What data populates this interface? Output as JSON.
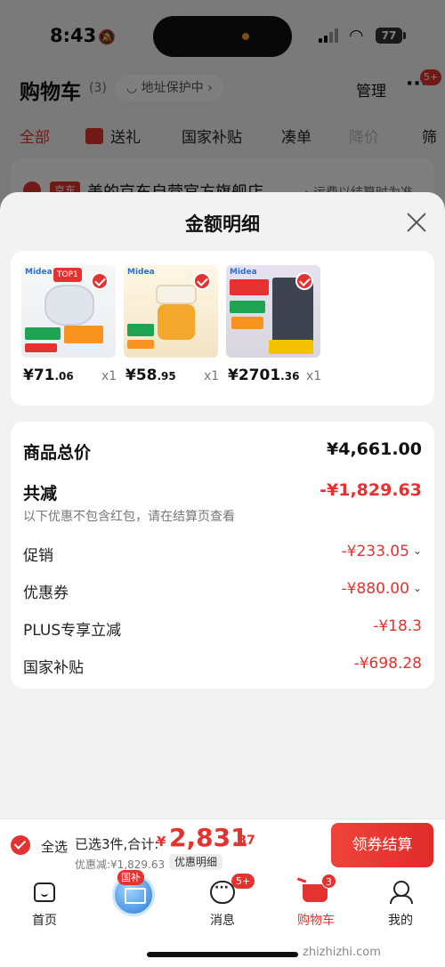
{
  "status": {
    "time": "8:43",
    "battery": "77"
  },
  "header": {
    "title": "购物车",
    "count": "(3)",
    "address_pill": "◡ 地址保护中 ›",
    "manage": "管理",
    "more_badge": "5+"
  },
  "tabs": [
    {
      "label": "全部"
    },
    {
      "label": "送礼"
    },
    {
      "label": "国家补贴"
    },
    {
      "label": "凑单"
    },
    {
      "label": "降价"
    },
    {
      "label": "筛"
    }
  ],
  "store": {
    "tag": "京东",
    "name": "美的京东自营官方旗舰店",
    "note": "› 运费以结算时为准"
  },
  "sheet": {
    "title": "金额明细",
    "products": [
      {
        "price_int": "¥71",
        "price_dec": ".06",
        "qty": "x1",
        "brand": "Midea",
        "badge": "TOP1"
      },
      {
        "price_int": "¥58",
        "price_dec": ".95",
        "qty": "x1",
        "brand": "Midea",
        "badge": ""
      },
      {
        "price_int": "¥2701",
        "price_dec": ".36",
        "qty": "x1",
        "brand": "Midea",
        "badge": ""
      }
    ],
    "summary": {
      "total_label": "商品总价",
      "total_value": "¥4,661.00",
      "reduce_label": "共减",
      "reduce_value": "-¥1,829.63",
      "reduce_note": "以下优惠不包含红包，请在结算页查看",
      "promo_label": "促销",
      "promo_value": "-¥233.05",
      "coupon_label": "优惠券",
      "coupon_value": "-¥880.00",
      "plus_label": "PLUS专享立减",
      "plus_value": "-¥18.3",
      "subsidy_label": "国家补贴",
      "subsidy_value": "-¥698.28"
    }
  },
  "checkout": {
    "select_all": "全选",
    "selected_text": "已选3件,合计:",
    "currency": "¥",
    "total_int": "2,831",
    "total_dec": ".37",
    "discount_text": "优惠减:¥1,829.63",
    "detail_link": "优惠明细",
    "button": "领券结算"
  },
  "tabbar": {
    "home": "首页",
    "gov_badge": "国补",
    "messages": "消息",
    "messages_badge": "5+",
    "cart": "购物车",
    "cart_badge": "3",
    "me": "我的"
  },
  "watermark": "zhizhizhi.com",
  "colors": {
    "accent": "#e3322f",
    "sheet_bg": "#f2f2f2"
  }
}
